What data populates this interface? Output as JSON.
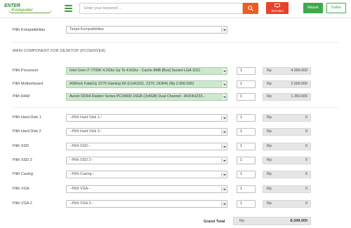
{
  "header": {
    "logo_line1": "ENTER",
    "logo_line2": "Komputer",
    "search_placeholder": "Enter your keyword ...",
    "simulasi_label": "Simulasi",
    "masuk_label": "Masuk",
    "daftar_label": "Daftar"
  },
  "compat": {
    "label": "Pilih Kompatibilitas",
    "value": "Tanpa Kompatibilitas"
  },
  "section_title": "MAIN COMPONENT FOR DESKTOP (PC/SERVER)",
  "rows": [
    {
      "label": "Pilih Processor",
      "value": "Intel Core i7-7700K 4.2Ghz Up To 4.5Ghz - Cache 8MB [Box] Socket LGA 1151 -",
      "qty": "1",
      "rp": "Rp",
      "price": "4.999.000"
    },
    {
      "label": "Pilih Motherboard",
      "value": "ASRock Fatal1ty Z270 Gaming K6 (LGA1151, Z270, DDR4) (Rp 2.000.000)",
      "qty": "1",
      "rp": "Rp",
      "price": "2.000.000"
    },
    {
      "label": "Pilih RAM",
      "value": "Avexir DDR4 Raiden Series PC24000 16GB (2x8GB) Dual Channel - AVD4UZ33...",
      "qty": "1",
      "rp": "Rp",
      "price": "1.350.000"
    },
    {
      "label": "Pilih Hard Disk 1",
      "value": "--Pilih Hard Disk 1--",
      "qty": "1",
      "rp": "Rp",
      "price": "0"
    },
    {
      "label": "Pilih Hard Disk 2",
      "value": "--Pilih Hard Disk 2--",
      "qty": "1",
      "rp": "Rp",
      "price": "0"
    },
    {
      "label": "Pilih SSD",
      "value": "--Pilih SSD--",
      "qty": "1",
      "rp": "Rp",
      "price": "0"
    },
    {
      "label": "Pilih SSD 2",
      "value": "--Pilih SSD 2--",
      "qty": "1",
      "rp": "Rp",
      "price": "0"
    },
    {
      "label": "Pilih Casing",
      "value": "--Pilih Casing--",
      "qty": "1",
      "rp": "Rp",
      "price": "0"
    },
    {
      "label": "Pilih VGA",
      "value": "--Pilih VGA--",
      "qty": "1",
      "rp": "Rp",
      "price": "0"
    },
    {
      "label": "Pilih VGA 2",
      "value": "--Pilih VGA 2--",
      "qty": "1",
      "rp": "Rp",
      "price": "0"
    }
  ],
  "total": {
    "label": "Grand Total",
    "rp": "Rp",
    "value": "8.349.000"
  },
  "colors": {
    "brand_green": "#3eaa49",
    "search_orange": "#f05a22",
    "simulasi_red": "#e8412b",
    "selected_fill": "#cde8cf"
  },
  "icons": [
    "menu-icon",
    "search-icon",
    "monitor-icon",
    "chevron-down-icon"
  ]
}
